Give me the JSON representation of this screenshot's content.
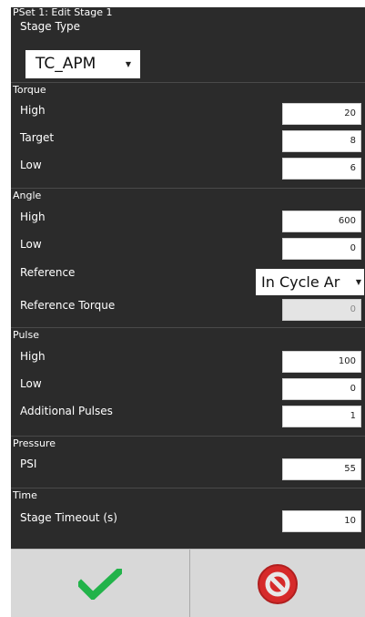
{
  "header": {
    "title": "PSet 1: Edit Stage 1"
  },
  "stage_type": {
    "label": "Stage Type",
    "value": "TC_APM"
  },
  "torque": {
    "section": "Torque",
    "high_label": "High",
    "high_value": "20",
    "target_label": "Target",
    "target_value": "8",
    "low_label": "Low",
    "low_value": "6"
  },
  "angle": {
    "section": "Angle",
    "high_label": "High",
    "high_value": "600",
    "low_label": "Low",
    "low_value": "0",
    "reference_label": "Reference",
    "reference_value": "In Cycle Ar",
    "ref_torque_label": "Reference Torque",
    "ref_torque_value": "0"
  },
  "pulse": {
    "section": "Pulse",
    "high_label": "High",
    "high_value": "100",
    "low_label": "Low",
    "low_value": "0",
    "additional_label": "Additional Pulses",
    "additional_value": "1"
  },
  "pressure": {
    "section": "Pressure",
    "psi_label": "PSI",
    "psi_value": "55"
  },
  "time": {
    "section": "Time",
    "timeout_label": "Stage Timeout (s)",
    "timeout_value": "10"
  },
  "footer": {
    "confirm_icon": "checkmark-icon",
    "cancel_icon": "cancel-icon"
  },
  "colors": {
    "background": "#2b2b2b",
    "confirm": "#22b34a",
    "cancel": "#d62a2a"
  }
}
